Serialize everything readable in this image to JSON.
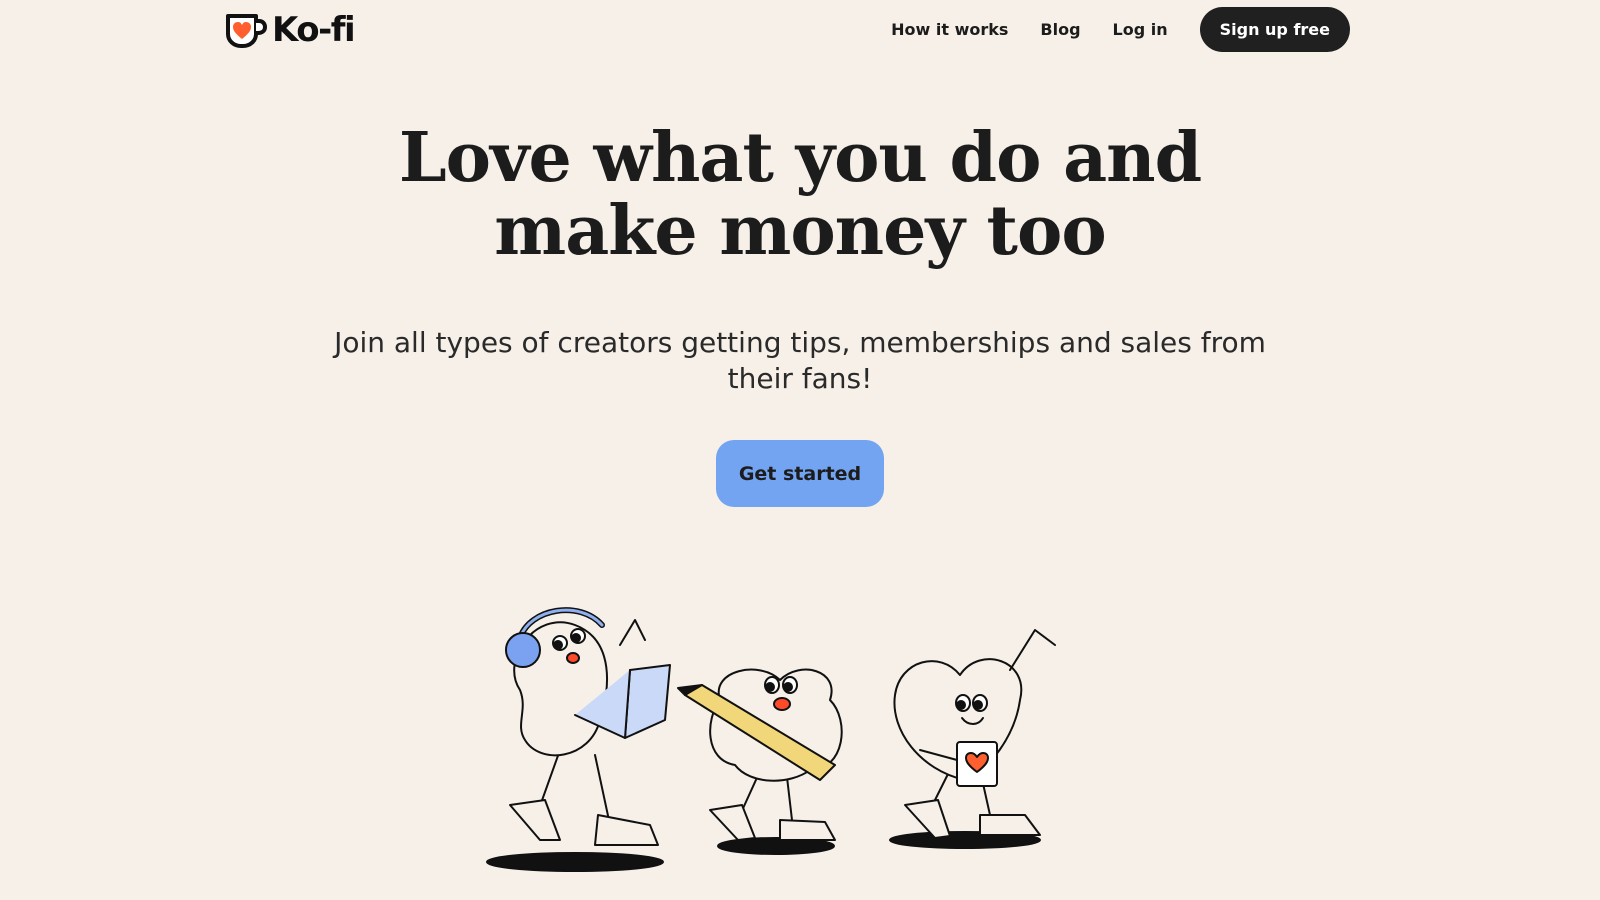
{
  "brand": {
    "name": "Ko-fi",
    "accent": "#ff5f5f"
  },
  "nav": {
    "links": [
      "How it works",
      "Blog",
      "Log in"
    ],
    "signup_label": "Sign up free"
  },
  "hero": {
    "title_line1": "Love what you do and",
    "title_line2": "make money too",
    "subtitle": "Join all types of creators getting tips, memberships and sales from their fans!",
    "cta_label": "Get started",
    "cta_color": "#72a4f2"
  },
  "colors": {
    "background": "#f6f0e9",
    "dark": "#202020"
  },
  "icons": [
    "ko-fi-cup-icon"
  ]
}
